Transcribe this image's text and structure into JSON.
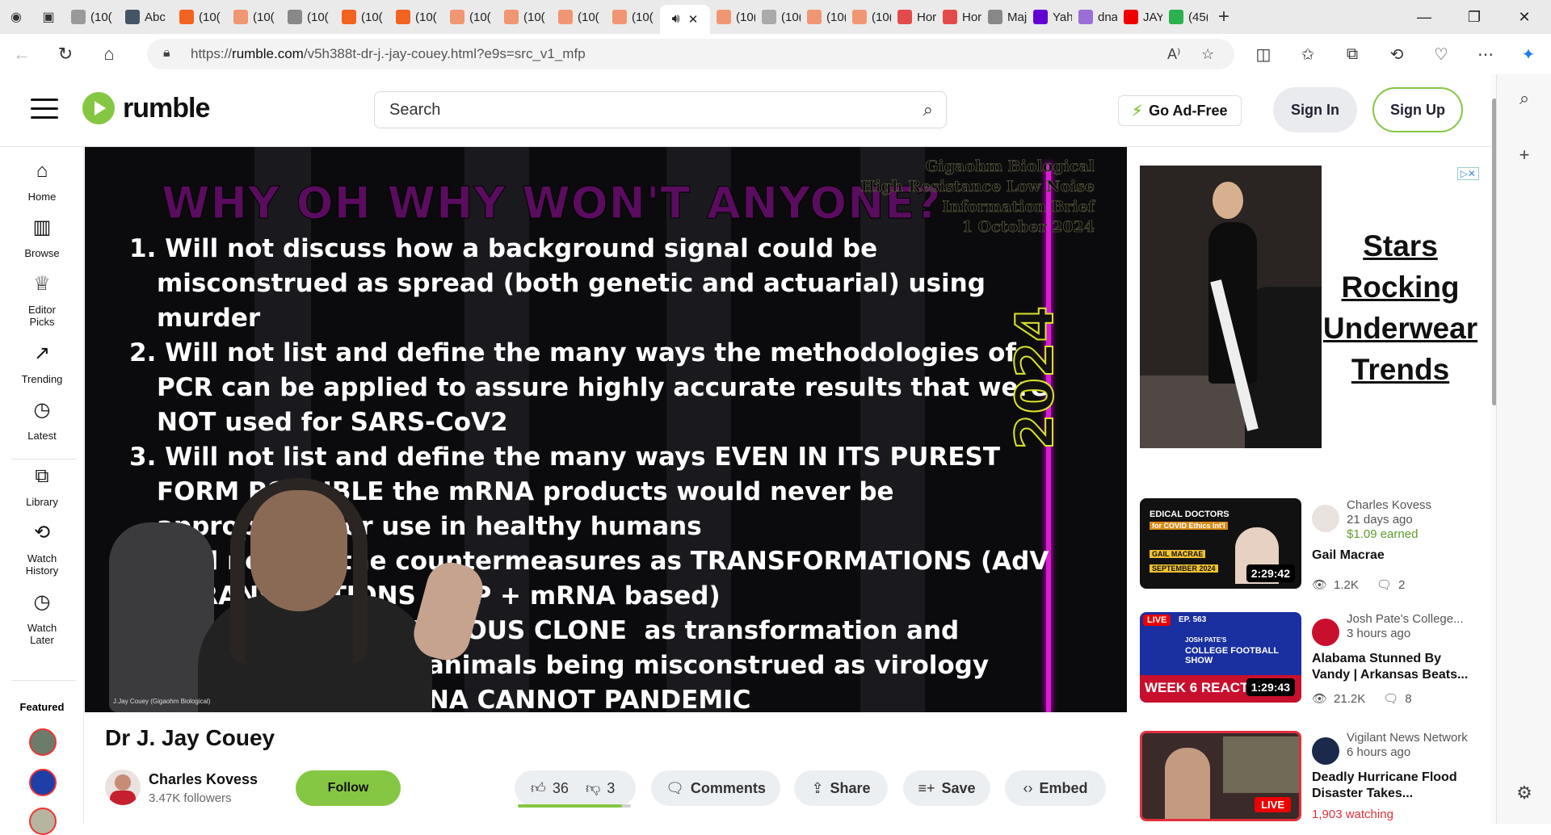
{
  "browser": {
    "tabs": [
      {
        "label": "(10(",
        "color": "#999"
      },
      {
        "label": "Abc",
        "color": "#456"
      },
      {
        "label": "(10(",
        "color": "#f26322"
      },
      {
        "label": "(10(",
        "color": "#f19672"
      },
      {
        "label": "(10(",
        "color": "#888"
      },
      {
        "label": "(10(",
        "color": "#f26322"
      },
      {
        "label": "(10(",
        "color": "#f26322"
      },
      {
        "label": "(10(",
        "color": "#f19672"
      },
      {
        "label": "(10(",
        "color": "#f19672"
      },
      {
        "label": "(10(",
        "color": "#f19672"
      },
      {
        "label": "(10(",
        "color": "#f19672"
      }
    ],
    "tabs_after": [
      {
        "label": "(10(",
        "color": "#f19672"
      },
      {
        "label": "(10(",
        "color": "#aaa"
      },
      {
        "label": "(10(",
        "color": "#f19672"
      },
      {
        "label": "(10(",
        "color": "#f19672"
      },
      {
        "label": "Hor",
        "color": "#e34b4b"
      },
      {
        "label": "Hor",
        "color": "#e34b4b"
      },
      {
        "label": "Maj",
        "color": "#888"
      },
      {
        "label": "Yah",
        "color": "#6001d2"
      },
      {
        "label": "dna",
        "color": "#9b6ed6"
      },
      {
        "label": "JAY",
        "color": "#e00"
      },
      {
        "label": "(45(",
        "color": "#2bb24c"
      }
    ],
    "url_prefix": "https://",
    "url_host": "rumble.com",
    "url_path": "/v5h388t-dr-j.-jay-couey.html?e9s=src_v1_mfp"
  },
  "header": {
    "search_placeholder": "Search",
    "logo_text": "rumble",
    "ad_free_label": "Go Ad-Free",
    "sign_in_label": "Sign In",
    "sign_up_label": "Sign Up"
  },
  "sidebar": {
    "items": [
      {
        "label": "Home",
        "icon": "home-icon"
      },
      {
        "label": "Browse",
        "icon": "browse-icon"
      },
      {
        "label": "Editor Picks",
        "icon": "award-icon"
      },
      {
        "label": "Trending",
        "icon": "trending-icon"
      },
      {
        "label": "Latest",
        "icon": "clock-icon"
      },
      {
        "label": "Library",
        "icon": "library-icon"
      },
      {
        "label": "Watch History",
        "icon": "history-icon"
      },
      {
        "label": "Watch Later",
        "icon": "clock-icon"
      }
    ],
    "featured_title": "Featured"
  },
  "video_frame": {
    "heading": "WHY OH WHY WON'T ANYONE?",
    "brand_lines": [
      "Gigaohm Biological",
      "High Resistance Low Noise",
      "Information Brief",
      "1 October 2024"
    ],
    "list_items": [
      "1. Will not discuss how a background signal could be misconstrued as spread (both genetic and actuarial) using murder",
      "2. Will not list and define the many ways the methodologies of PCR can be applied to assure highly accurate results that were NOT used for SARS-CoV2",
      "3. Will not list and define the many ways EVEN IN ITS PUREST FORM POSSIBLE the mRNA products would never be appropriate for use in healthy humans",
      "4. Will ne      e the countermeasures as TRANSFORMATIONS (AdV",
      "        RANSFECTIONS (LNP + mRNA based)",
      "        e the term INFECTIOUS CLONE  as transformation and",
      "        cell culture and animals being misconstrued as virology",
      "        the statement RNA CANNOT PANDEMIC"
    ],
    "year": "2024",
    "watermark": "J.Jay Couey (Gigaohm Biological)"
  },
  "video": {
    "title": "Dr J. Jay Couey",
    "channel_name": "Charles Kovess",
    "followers": "3.47K followers",
    "follow_label": "Follow",
    "likes": "36",
    "dislikes": "3",
    "like_ratio": 0.92,
    "comments_label": "Comments",
    "share_label": "Share",
    "save_label": "Save",
    "embed_label": "Embed"
  },
  "ad": {
    "headline": "Stars Rocking Underwear Trends",
    "choice_label": "▷✕"
  },
  "recommendations": [
    {
      "channel": "Charles Kovess",
      "age": "21 days ago",
      "earned": "$1.09 earned",
      "title": "Gail Macrae",
      "duration": "2:29:42",
      "views": "1.2K",
      "comments": "2",
      "thumb_text_1": "EDICAL DOCTORS",
      "thumb_text_2": "for COVID Ethics Int'l",
      "thumb_text_3": "GAIL MACRAE",
      "thumb_text_4": "SEPTEMBER 2024"
    },
    {
      "channel": "Josh Pate's College...",
      "age": "3 hours ago",
      "title": "Alabama Stunned By Vandy | Arkansas Beats...",
      "duration": "1:29:43",
      "views": "21.2K",
      "comments": "8",
      "thumb_live": "LIVE",
      "thumb_text_1": "EP. 563",
      "thumb_text_2": "JOSH PATE'S",
      "thumb_text_3": "COLLEGE FOOTBALL SHOW",
      "thumb_text_4": "WEEK 6 REACTIO"
    },
    {
      "channel": "Vigilant News Network",
      "age": "6 hours ago",
      "title": "Deadly Hurricane Flood Disaster Takes...",
      "watching": "1,903 watching",
      "thumb_live": "LIVE"
    }
  ]
}
